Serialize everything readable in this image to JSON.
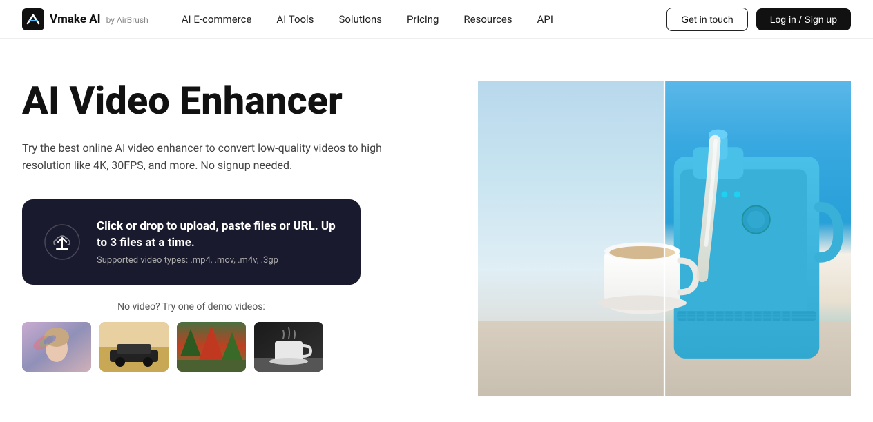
{
  "brand": {
    "logo_text": "Vmake AI",
    "logo_by": "by AirBrush"
  },
  "nav": {
    "links": [
      {
        "label": "AI E-commerce",
        "id": "ai-ecommerce"
      },
      {
        "label": "AI Tools",
        "id": "ai-tools"
      },
      {
        "label": "Solutions",
        "id": "solutions"
      },
      {
        "label": "Pricing",
        "id": "pricing"
      },
      {
        "label": "Resources",
        "id": "resources"
      },
      {
        "label": "API",
        "id": "api"
      }
    ],
    "get_in_touch": "Get in touch",
    "login_signup": "Log in / Sign up"
  },
  "hero": {
    "title": "AI Video Enhancer",
    "subtitle": "Try the best online AI video enhancer to convert low-quality videos to high resolution like 4K, 30FPS, and more. No signup needed.",
    "upload_main": "Click or drop to upload, paste files or URL. Up to 3 files at a time.",
    "upload_sub": "Supported video types: .mp4, .mov, .m4v, .3gp",
    "demo_label": "No video? Try one of demo videos:",
    "demo_thumbs": [
      {
        "id": "thumb-person",
        "alt": "Person demo video"
      },
      {
        "id": "thumb-car",
        "alt": "Car in desert demo video"
      },
      {
        "id": "thumb-nature",
        "alt": "Nature demo video"
      },
      {
        "id": "thumb-cup",
        "alt": "Cup demo video"
      }
    ]
  }
}
